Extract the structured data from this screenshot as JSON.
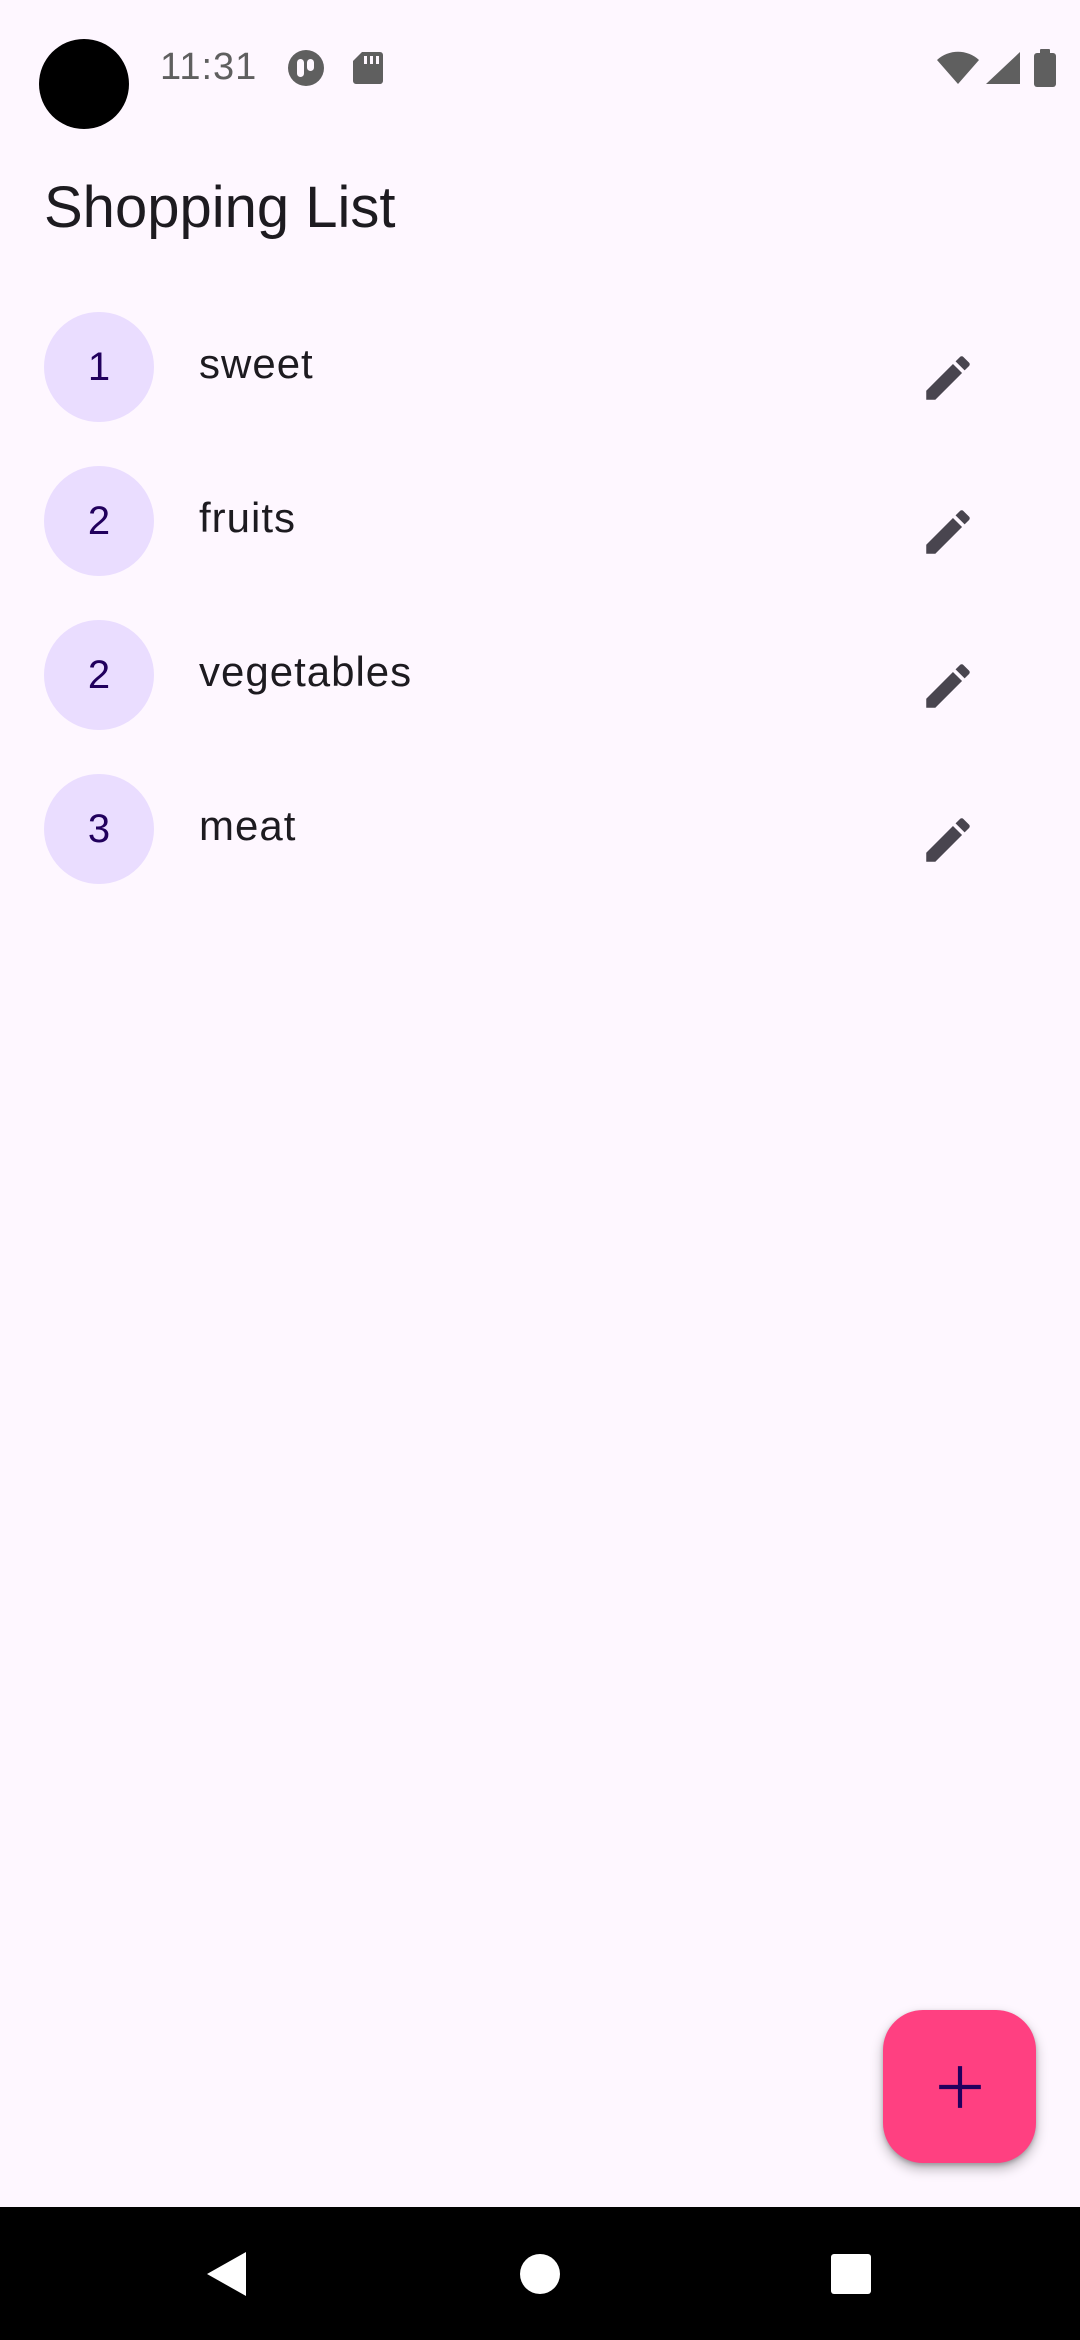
{
  "status_bar": {
    "time": "11:31",
    "icons": [
      "camera-cutout",
      "app-notification-icon",
      "sd-card-icon",
      "wifi-icon",
      "signal-icon",
      "battery-icon"
    ]
  },
  "header": {
    "title": "Shopping List"
  },
  "list": {
    "items": [
      {
        "quantity": "1",
        "name": "sweet"
      },
      {
        "quantity": "2",
        "name": "fruits"
      },
      {
        "quantity": "2",
        "name": "vegetables"
      },
      {
        "quantity": "3",
        "name": "meat"
      }
    ],
    "edit_icon": "pencil-icon"
  },
  "fab": {
    "icon": "plus-icon"
  },
  "navigation": {
    "icons": [
      "back-triangle-icon",
      "home-circle-icon",
      "recents-square-icon"
    ]
  },
  "colors": {
    "background": "#FEF7FF",
    "avatar_bg": "#EADDFF",
    "avatar_text": "#21005D",
    "fab_bg": "#FF4081",
    "icon_gray": "#49454F",
    "nav_bg": "#000000"
  }
}
